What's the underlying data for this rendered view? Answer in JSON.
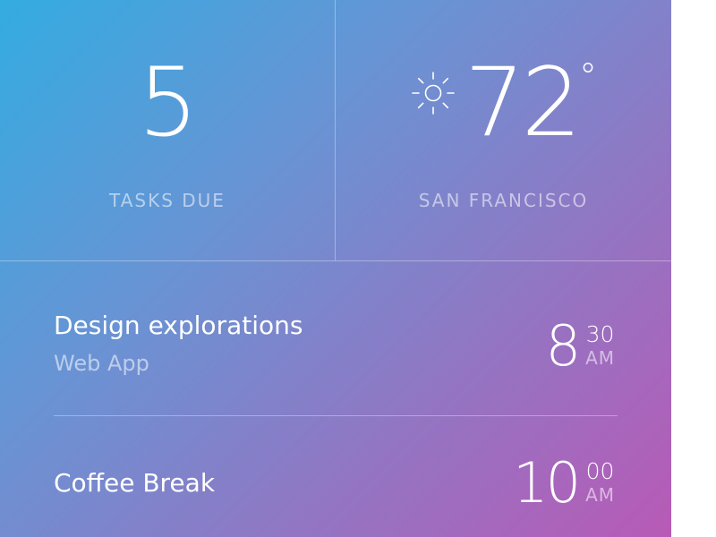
{
  "tasks": {
    "count": "5",
    "label": "TASKS DUE"
  },
  "weather": {
    "icon": "sun-icon",
    "temperature": "72",
    "unit": "°",
    "city": "SAN FRANCISCO"
  },
  "events": [
    {
      "title": "Design explorations",
      "subtitle": "Web App",
      "hour": "8",
      "minutes": "30",
      "ampm": "AM"
    },
    {
      "title": "Coffee Break",
      "subtitle": "",
      "hour": "10",
      "minutes": "00",
      "ampm": "AM"
    }
  ],
  "colors": {
    "gradient_start": "#33ace1",
    "gradient_mid": "#8f78c4",
    "gradient_end": "#b85ab6",
    "text": "#ffffff"
  }
}
